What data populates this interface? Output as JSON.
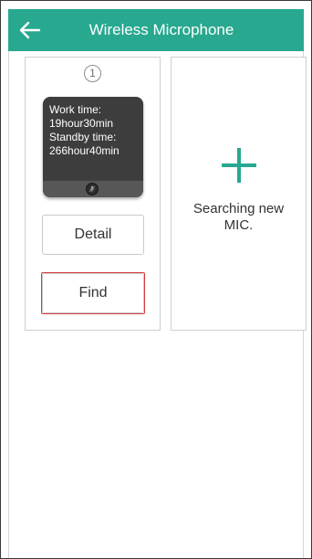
{
  "header": {
    "title": "Wireless Microphone",
    "back_icon": "arrow-left-icon"
  },
  "mic_card": {
    "index": "1",
    "work_time_label": "Work time:",
    "work_time_value": "19hour30min",
    "standby_time_label": "Standby time:",
    "standby_time_value": "266hour40min",
    "mic_icon": "microphone-muted-icon",
    "detail_label": "Detail",
    "find_label": "Find"
  },
  "add_card": {
    "plus_icon": "plus-icon",
    "label": "Searching new MIC."
  },
  "colors": {
    "accent": "#27a88f",
    "panel": "#3d3d3d",
    "find_outline": "#d73a3a"
  }
}
